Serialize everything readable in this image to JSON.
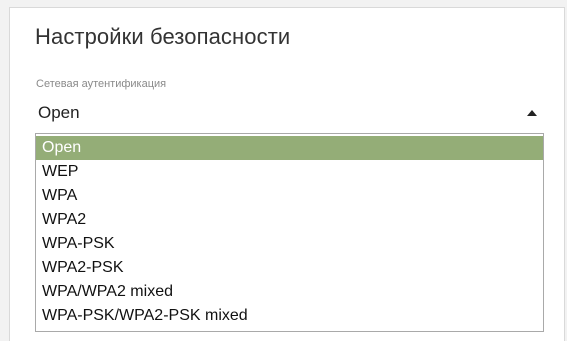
{
  "panel": {
    "title": "Настройки безопасности"
  },
  "auth": {
    "label": "Сетевая аутентификация",
    "selected_value": "Open",
    "dropdown_open": true,
    "caret_icon": "caret-up-icon",
    "highlight_color": "#94ad77",
    "options": [
      {
        "label": "Open",
        "selected": true
      },
      {
        "label": "WEP",
        "selected": false
      },
      {
        "label": "WPA",
        "selected": false
      },
      {
        "label": "WPA2",
        "selected": false
      },
      {
        "label": "WPA-PSK",
        "selected": false
      },
      {
        "label": "WPA2-PSK",
        "selected": false
      },
      {
        "label": "WPA/WPA2 mixed",
        "selected": false
      },
      {
        "label": "WPA-PSK/WPA2-PSK mixed",
        "selected": false
      }
    ]
  }
}
